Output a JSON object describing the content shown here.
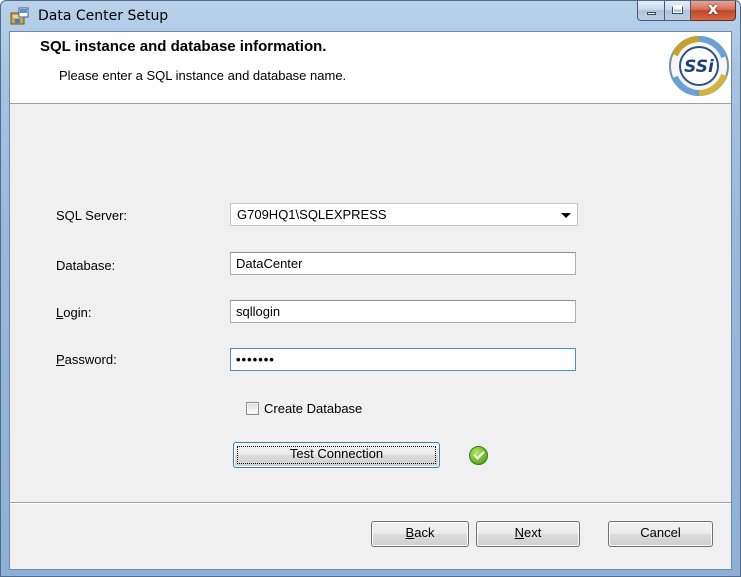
{
  "window": {
    "title": "Data Center Setup",
    "minimize_glyph": "",
    "maximize_glyph": "",
    "close_glyph": "x"
  },
  "banner": {
    "title": "SQL instance and database information.",
    "subtitle": "Please enter a SQL instance and database name.",
    "logo_text": "SSi"
  },
  "form": {
    "sql_server_label": "SQL Server:",
    "sql_server_value": "G709HQ1\\SQLEXPRESS",
    "database_label": "Database:",
    "database_value": "DataCenter",
    "login_label_prefix": "L",
    "login_label_rest": "ogin:",
    "login_value": "sqllogin",
    "password_label_prefix": "P",
    "password_label_rest": "assword:",
    "password_value": "•••••••",
    "create_database_label": "Create Database",
    "create_database_checked": false,
    "test_connection_label": "Test Connection",
    "connection_status_icon": "check-circle-icon"
  },
  "footer": {
    "back_prefix": "B",
    "back_rest": "ack",
    "next_prefix": "N",
    "next_rest": "ext",
    "cancel_label": "Cancel"
  },
  "colors": {
    "title_bar": "#a9c4e2",
    "client_bg": "#f0f0f0",
    "success_green": "#6cbe2e",
    "close_button": "#c0462c"
  }
}
